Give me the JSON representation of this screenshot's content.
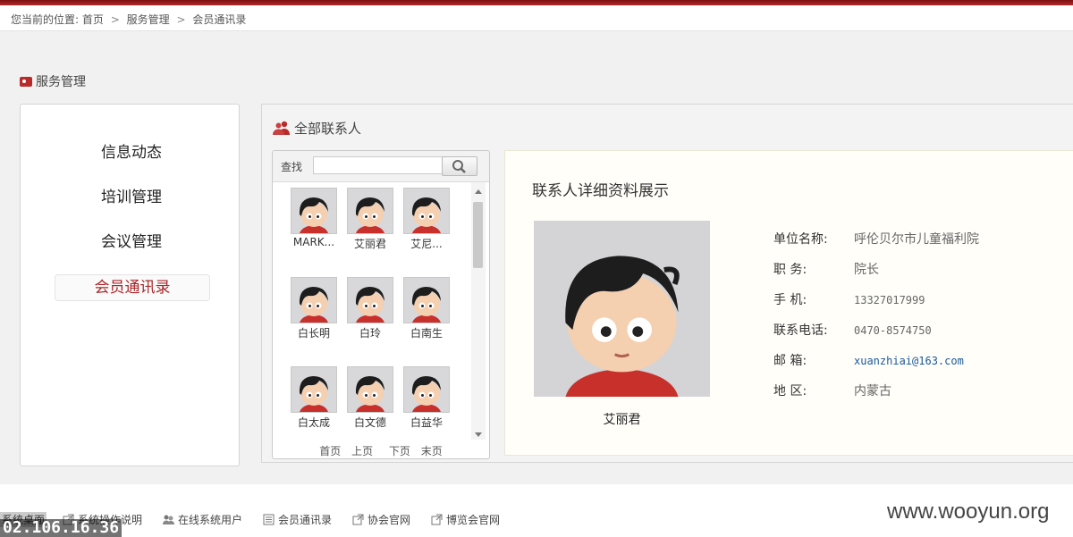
{
  "breadcrumb": {
    "prefix": "您当前的位置:",
    "items": [
      "首页",
      "服务管理",
      "会员通讯录"
    ],
    "separator": ">"
  },
  "section": {
    "title": "服务管理"
  },
  "left_nav": {
    "items": [
      {
        "label": "信息动态",
        "active": false
      },
      {
        "label": "培训管理",
        "active": false
      },
      {
        "label": "会议管理",
        "active": false
      },
      {
        "label": "会员通讯录",
        "active": true
      }
    ]
  },
  "contacts": {
    "title": "全部联系人",
    "search_label": "查找",
    "search_value": "",
    "items": [
      "MARK...",
      "艾丽君",
      "艾尼...",
      "白长明",
      "白玲",
      "白南生",
      "白太成",
      "白文德",
      "白益华"
    ],
    "pager": [
      "首页",
      "上页",
      "下页",
      "末页"
    ]
  },
  "detail": {
    "heading": "联系人详细资料展示",
    "name": "艾丽君",
    "fields": [
      {
        "key": "单位名称:",
        "value": "呼伦贝尔市儿童福利院",
        "style": "plain"
      },
      {
        "key": "职  务:",
        "value": "院长",
        "style": "plain"
      },
      {
        "key": "手  机:",
        "value": "13327017999",
        "style": "mono"
      },
      {
        "key": "联系电话:",
        "value": "0470-8574750",
        "style": "mono"
      },
      {
        "key": "邮  箱:",
        "value": "xuanzhiai@163.com",
        "style": "link"
      },
      {
        "key": "地  区:",
        "value": "内蒙古",
        "style": "plain"
      }
    ]
  },
  "footer": {
    "desktop": "系统桌面",
    "links": [
      "系统操作说明",
      "在线系统用户",
      "会员通讯录",
      "协会官网",
      "博览会官网"
    ],
    "watermark": "www.wooyun.org",
    "ip": "02.106.16.36"
  },
  "colors": {
    "accent": "#a8282b",
    "topbar": "#8f1c1d"
  }
}
